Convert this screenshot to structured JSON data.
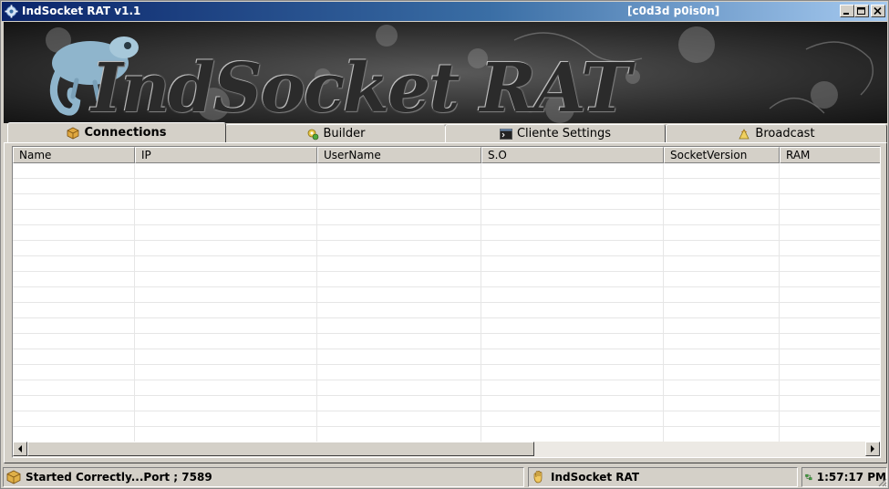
{
  "window": {
    "title": "IndSocket RAT v1.1",
    "subtitle": "[c0d3d p0is0n]",
    "icon": "gear-icon",
    "controls": [
      "minimize-icon",
      "maximize-icon",
      "close-icon"
    ]
  },
  "banner": {
    "logo_text": "IndSocket RAT",
    "mascot": "chameleon"
  },
  "tabs": [
    {
      "label": "Connections",
      "icon": "package-icon",
      "active": true
    },
    {
      "label": "Builder",
      "icon": "gear-badge-icon",
      "active": false
    },
    {
      "label": "Cliente Settings",
      "icon": "console-icon",
      "active": false
    },
    {
      "label": "Broadcast",
      "icon": "broadcast-icon",
      "active": false
    }
  ],
  "connections_table": {
    "columns": [
      "Name",
      "IP",
      "UserName",
      "S.O",
      "SocketVersion",
      "RAM"
    ],
    "rows": []
  },
  "statusbar": {
    "status_text": "Started Correctly...Port ; 7589",
    "app_text": "IndSocket RAT",
    "time_text": "1:57:17 PM"
  },
  "colors": {
    "titlebar_start": "#0a246a",
    "titlebar_end": "#a6caf0",
    "face": "#d4d0c8"
  }
}
